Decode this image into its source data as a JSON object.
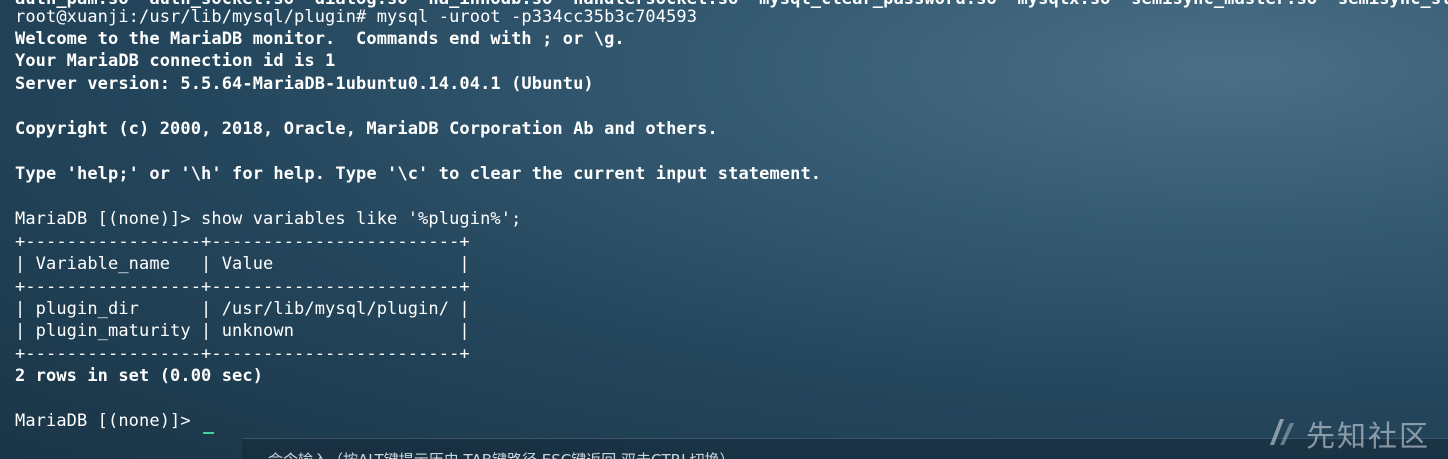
{
  "terminal": {
    "lines": [
      {
        "text": "auth_pam.so  auth_socket.so  dialog.so  ha_innodb.so  handlersocket.so  mysql_clear_password.so  mysqlx.so  semisync_master.so  semisync_slave.so",
        "weight": "bold"
      },
      {
        "text": "root@xuanji:/usr/lib/mysql/plugin# mysql -uroot -p334cc35b3c704593",
        "weight": "normal"
      },
      {
        "text": "Welcome to the MariaDB monitor.  Commands end with ; or \\g.",
        "weight": "bold"
      },
      {
        "text": "Your MariaDB connection id is 1",
        "weight": "bold"
      },
      {
        "text": "Server version: 5.5.64-MariaDB-1ubuntu0.14.04.1 (Ubuntu)",
        "weight": "bold"
      },
      {
        "text": "",
        "weight": "bold"
      },
      {
        "text": "Copyright (c) 2000, 2018, Oracle, MariaDB Corporation Ab and others.",
        "weight": "bold"
      },
      {
        "text": "",
        "weight": "bold"
      },
      {
        "text": "Type 'help;' or '\\h' for help. Type '\\c' to clear the current input statement.",
        "weight": "bold"
      },
      {
        "text": "",
        "weight": "bold"
      },
      {
        "text": "MariaDB [(none)]> show variables like '%plugin%';",
        "weight": "normal"
      },
      {
        "text": "+-----------------+------------------------+",
        "weight": "normal"
      },
      {
        "text": "| Variable_name   | Value                  |",
        "weight": "normal"
      },
      {
        "text": "+-----------------+------------------------+",
        "weight": "normal"
      },
      {
        "text": "| plugin_dir      | /usr/lib/mysql/plugin/ |",
        "weight": "normal"
      },
      {
        "text": "| plugin_maturity | unknown                |",
        "weight": "normal"
      },
      {
        "text": "+-----------------+------------------------+",
        "weight": "normal"
      },
      {
        "text": "2 rows in set (0.00 sec)",
        "weight": "bold"
      },
      {
        "text": "",
        "weight": "bold"
      },
      {
        "text": "MariaDB [(none)]>",
        "weight": "normal"
      }
    ]
  },
  "hint_bar": {
    "text": "命令输入（按ALT键提示历史,TAB键路径,ESC键返回,双击CTRL切换）"
  },
  "watermark": {
    "text": "先知社区"
  },
  "colors": {
    "text": "#ffffff",
    "cursor": "#3fd0a0"
  }
}
